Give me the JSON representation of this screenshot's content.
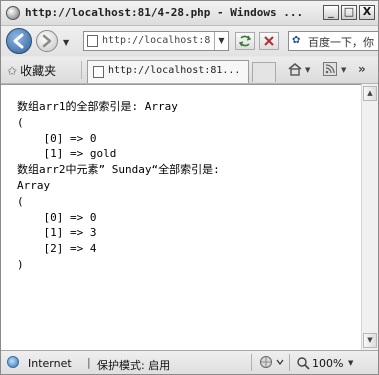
{
  "window": {
    "title": "http://localhost:81/4-28.php - Windows ...",
    "minimize_label": "_",
    "maximize_label": "□",
    "close_label": "X"
  },
  "navigation": {
    "address": "http://localhost:8",
    "address_dropdown": "▼",
    "search_text": "百度一下，你"
  },
  "tabs": {
    "favorites_label": "收藏夹",
    "active_tab_title": "http://localhost:81..."
  },
  "content": {
    "lines": [
      "数组arr1的全部索引是: Array",
      "(",
      "    [0] => 0",
      "    [1] => gold",
      "数组arr2中元素” Sunday“全部索引是:",
      "Array",
      "(",
      "    [0] => 0",
      "    [1] => 3",
      "    [2] => 4",
      ")"
    ]
  },
  "status": {
    "zone_label": "Internet",
    "separator": "|",
    "protected_mode": "保护模式: 启用",
    "zoom_level": "100%"
  },
  "icons": {
    "back": "back-arrow-icon",
    "forward": "forward-arrow-icon",
    "refresh": "refresh-icon",
    "stop": "stop-icon",
    "home": "home-icon",
    "rss": "rss-feed-icon",
    "star": "favorites-star-icon",
    "globe": "internet-zone-icon"
  },
  "colors": {
    "back_button": "#3f6fa8",
    "window_bg": "#e8e8e8"
  }
}
